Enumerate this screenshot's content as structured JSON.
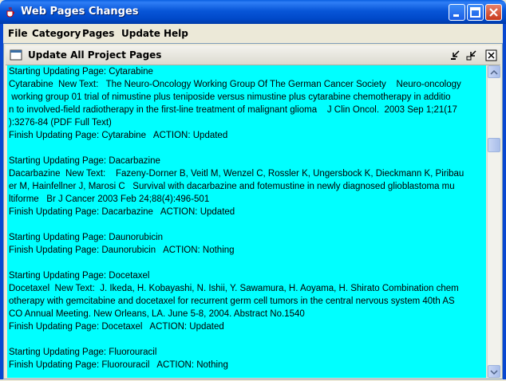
{
  "window": {
    "title": "Web Pages Changes",
    "icons": {
      "app": "java-cup-icon",
      "minimize": "minimize-icon",
      "maximize": "maximize-icon",
      "close": "close-icon"
    }
  },
  "menu": {
    "items": [
      "File",
      "Category",
      "Pages",
      "Update",
      "Help"
    ]
  },
  "internal_frame": {
    "title": "Update All Project Pages",
    "icons": {
      "frame": "internal-frame-icon",
      "iconify": "iconify-icon",
      "restore": "restore-icon",
      "close": "close-icon"
    }
  },
  "log": {
    "lines": [
      "Starting Updating Page: Cytarabine",
      "Cytarabine  New Text:   The Neuro-Oncology Working Group Of The German Cancer Society    Neuro-oncology",
      " working group 01 trial of nimustine plus teniposide versus nimustine plus cytarabine chemotherapy in additio",
      "n to involved-field radiotherapy in the first-line treatment of malignant glioma    J Clin Oncol.  2003 Sep 1;21(17",
      "):3276-84 (PDF Full Text)",
      "Finish Updating Page: Cytarabine   ACTION: Updated",
      "",
      "Starting Updating Page: Dacarbazine",
      "Dacarbazine  New Text:    Fazeny-Dorner B, Veitl M, Wenzel C, Rossler K, Ungersbock K, Dieckmann K, Piribau",
      "er M, Hainfellner J, Marosi C   Survival with dacarbazine and fotemustine in newly diagnosed glioblastoma mu",
      "ltiforme   Br J Cancer 2003 Feb 24;88(4):496-501",
      "Finish Updating Page: Dacarbazine   ACTION: Updated",
      "",
      "Starting Updating Page: Daunorubicin",
      "Finish Updating Page: Daunorubicin   ACTION: Nothing",
      "",
      "Starting Updating Page: Docetaxel",
      "Docetaxel  New Text:  J. Ikeda, H. Kobayashi, N. Ishii, Y. Sawamura, H. Aoyama, H. Shirato Combination chem",
      "otherapy with gemcitabine and docetaxel for recurrent germ cell tumors in the central nervous system 40th AS",
      "CO Annual Meeting. New Orleans, LA. June 5-8, 2004. Abstract No.1540",
      "Finish Updating Page: Docetaxel   ACTION: Updated",
      "",
      "Starting Updating Page: Fluorouracil",
      "Finish Updating Page: Fluorouracil   ACTION: Nothing"
    ]
  },
  "scrollbar": {
    "position_fraction": 0.22
  },
  "colors": {
    "log_background": "#00ffff",
    "titlebar": "#0054e3"
  }
}
